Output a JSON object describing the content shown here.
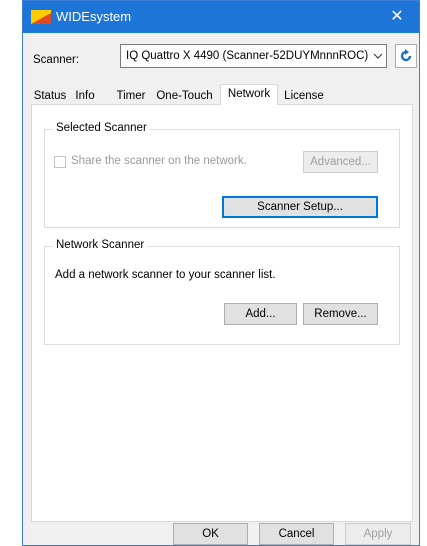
{
  "window": {
    "title": "WIDEsystem",
    "close_label": "✕",
    "logo_colors": [
      "#ffcc00",
      "#e04a1e"
    ]
  },
  "scanner": {
    "label": "Scanner:",
    "selected": "IQ Quattro X 4490 (Scanner-52DUYMnnnROC)",
    "refresh_icon": "refresh-icon"
  },
  "tabs": [
    "Status",
    "Info",
    "Timer",
    "One-Touch",
    "Network",
    "License"
  ],
  "active_tab": "Network",
  "selected_scanner": {
    "title": "Selected Scanner",
    "share_label": "Share the scanner on the network.",
    "share_checked": false,
    "advanced_label": "Advanced...",
    "setup_label": "Scanner Setup..."
  },
  "network_scanner": {
    "title": "Network Scanner",
    "description": "Add a network scanner to your scanner list.",
    "add_label": "Add...",
    "remove_label": "Remove..."
  },
  "footer": {
    "ok_label": "OK",
    "cancel_label": "Cancel",
    "apply_label": "Apply"
  },
  "colors": {
    "titlebar": "#1e75d8",
    "accent": "#0078d7",
    "refresh": "#1a73c9"
  }
}
